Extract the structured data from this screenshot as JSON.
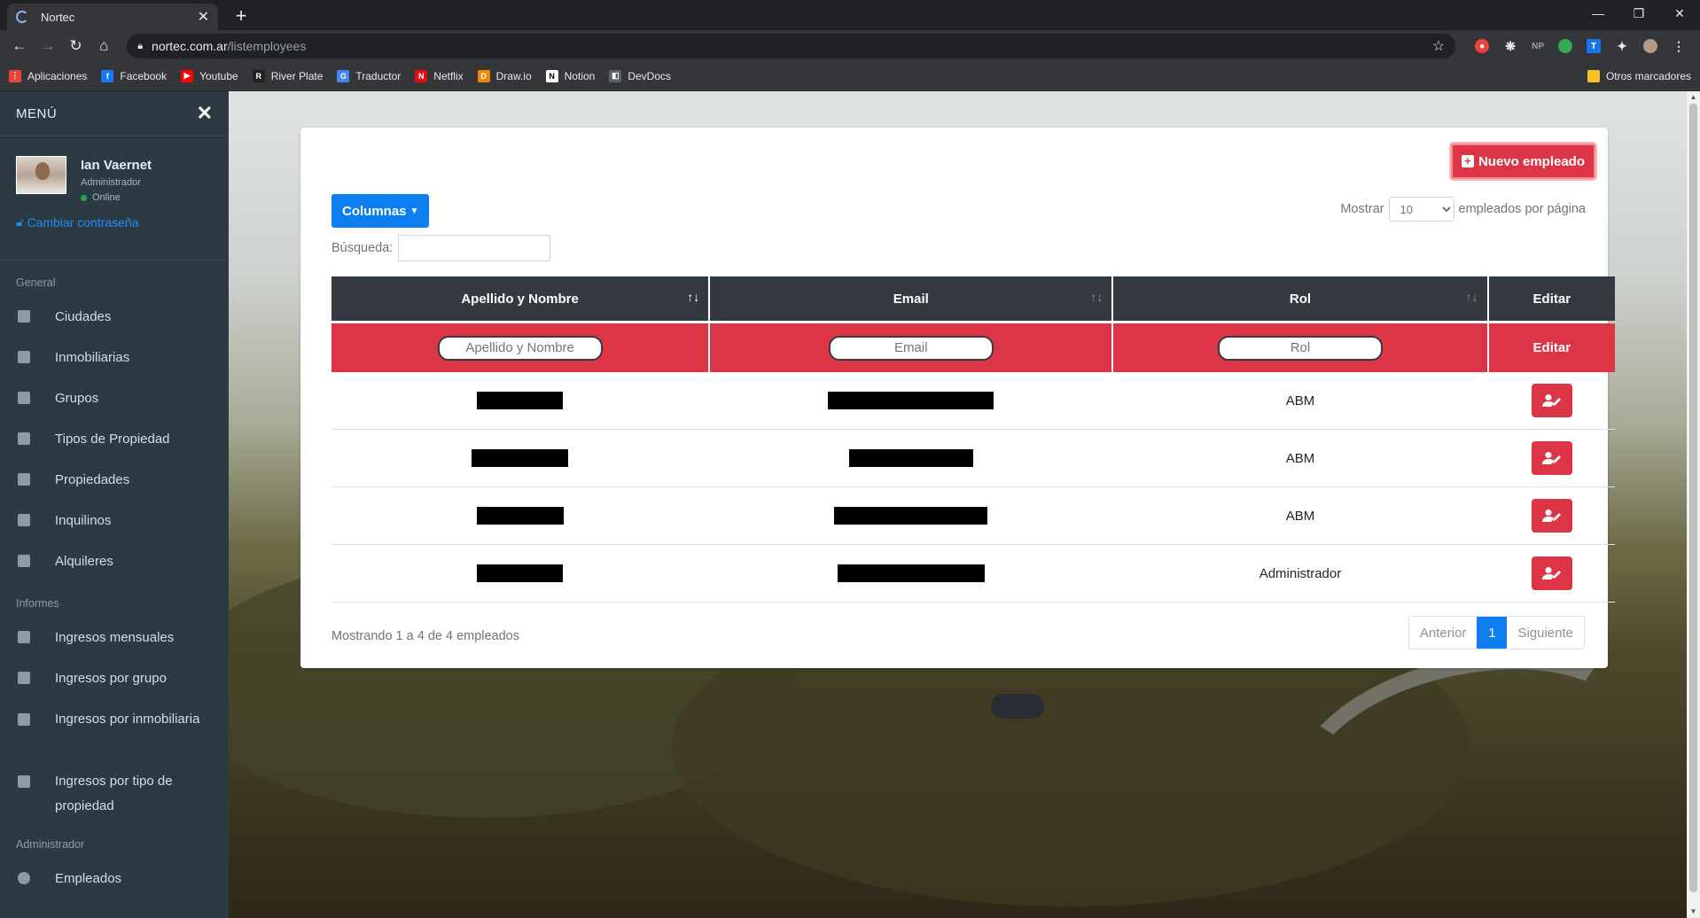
{
  "browser": {
    "tab_title": "Nortec",
    "url_host": "nortec.com.ar",
    "url_path": "/listemployees",
    "bookmarks": [
      {
        "label": "Aplicaciones",
        "color": "#e8453c",
        "glyph": "⋮"
      },
      {
        "label": "Facebook",
        "color": "#1877f2",
        "glyph": "f"
      },
      {
        "label": "Youtube",
        "color": "#ff0000",
        "glyph": "▶"
      },
      {
        "label": "River Plate",
        "color": "#222222",
        "glyph": "R"
      },
      {
        "label": "Traductor",
        "color": "#4285f4",
        "glyph": "G"
      },
      {
        "label": "Netflix",
        "color": "#e50914",
        "glyph": "N"
      },
      {
        "label": "Draw.io",
        "color": "#f08705",
        "glyph": "D"
      },
      {
        "label": "Notion",
        "color": "#ffffff",
        "glyph": "N"
      },
      {
        "label": "DevDocs",
        "color": "#5f6368",
        "glyph": "◧"
      }
    ],
    "other_bookmarks": "Otros marcadores",
    "extensions_text": "NP"
  },
  "sidebar": {
    "menu_title": "MENÚ",
    "user_name": "Ian Vaernet",
    "user_role": "Administrador",
    "user_status": "Online",
    "change_password": "Cambiar contraseña",
    "section_general": "General",
    "general_items": [
      "Ciudades",
      "Inmobiliarias",
      "Grupos",
      "Tipos de Propiedad",
      "Propiedades",
      "Inquilinos",
      "Alquileres"
    ],
    "section_reports": "Informes",
    "reports_items": [
      "Ingresos mensuales",
      "Ingresos por grupo",
      "Ingresos por inmobiliaria",
      "Ingresos por tipo de propiedad"
    ],
    "section_admin": "Administrador",
    "admin_items": [
      "Empleados"
    ]
  },
  "card": {
    "new_button": "Nuevo empleado",
    "columns_button": "Columnas",
    "show_label": "Mostrar",
    "page_size": "10",
    "per_page_label": "empleados por página",
    "search_label": "Búsqueda:",
    "search_value": "",
    "headers": [
      "Apellido y Nombre",
      "Email",
      "Rol",
      "Editar"
    ],
    "filters": {
      "name_placeholder": "Apellido y Nombre",
      "email_placeholder": "Email",
      "role_placeholder": "Rol",
      "edit_label": "Editar"
    },
    "rows": [
      {
        "role": "ABM"
      },
      {
        "role": "ABM"
      },
      {
        "role": "ABM"
      },
      {
        "role": "Administrador"
      }
    ],
    "footer_info": "Mostrando 1 a 4 de 4 empleados",
    "pager": {
      "prev": "Anterior",
      "current": "1",
      "next": "Siguiente"
    }
  },
  "colors": {
    "accent_red": "#dc3545",
    "accent_blue": "#0d7ff0",
    "header_dark": "#343a40",
    "sidebar_bg": "#2c3a43"
  }
}
